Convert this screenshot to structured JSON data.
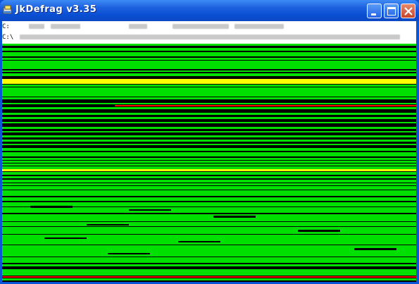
{
  "window": {
    "title": "JkDefrag v3.35",
    "buttons": [
      "minimize",
      "maximize",
      "close"
    ],
    "icon": "jkdefrag-app-icon"
  },
  "status": {
    "line1_prefix": "C:",
    "line2_prefix": "C:\\"
  },
  "map": {
    "legend_colors": {
      "fragmented": "#ff0000",
      "unfragmented": "#00e000",
      "mft": "#ffff00",
      "free": "#000000",
      "unmovable": "#00ffff"
    }
  }
}
